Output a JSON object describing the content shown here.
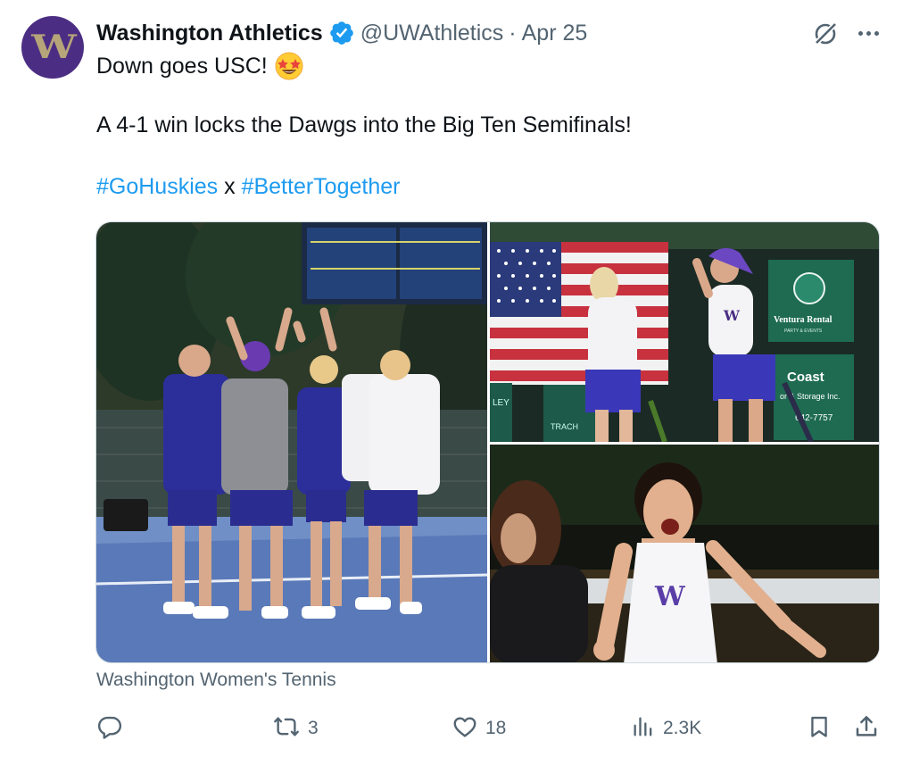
{
  "tweet": {
    "avatar_letter": "W",
    "display_name": "Washington Athletics",
    "handle": "@UWAthletics",
    "separator": "·",
    "date": "Apr 25",
    "line1": "Down goes USC!",
    "line2": "A 4-1 win locks the Dawgs into the Big Ten Semifinals!",
    "hashtag1": "#GoHuskies",
    "hashtag_joiner": " x ",
    "hashtag2": "#BetterTogether",
    "media_caption": "Washington Women's Tennis"
  },
  "photos": {
    "left": {
      "signs": {
        "board": ""
      }
    },
    "top_right": {
      "sign_brand": "Ventura Rental",
      "sign_sub": "PARTY & EVENTS",
      "sign2_a": "Coast",
      "sign2_b": "or & Storage Inc.",
      "sign2_c": "642-7757",
      "flag_text": "LEY",
      "banner_text": "TRACH"
    },
    "bottom_right": {}
  },
  "actions": {
    "reply_count": "",
    "repost_count": "3",
    "like_count": "18",
    "views_count": "2.3K"
  },
  "colors": {
    "brand_purple": "#4b2e83",
    "brand_gold": "#b7a57a",
    "link_blue": "#1d9bf0",
    "muted": "#536471",
    "verified_blue": "#1d9bf0"
  },
  "icons": [
    "verified-badge-icon",
    "grok-icon",
    "more-icon",
    "star-struck-emoji",
    "reply-icon",
    "repost-icon",
    "like-icon",
    "views-icon",
    "bookmark-icon",
    "share-icon"
  ]
}
